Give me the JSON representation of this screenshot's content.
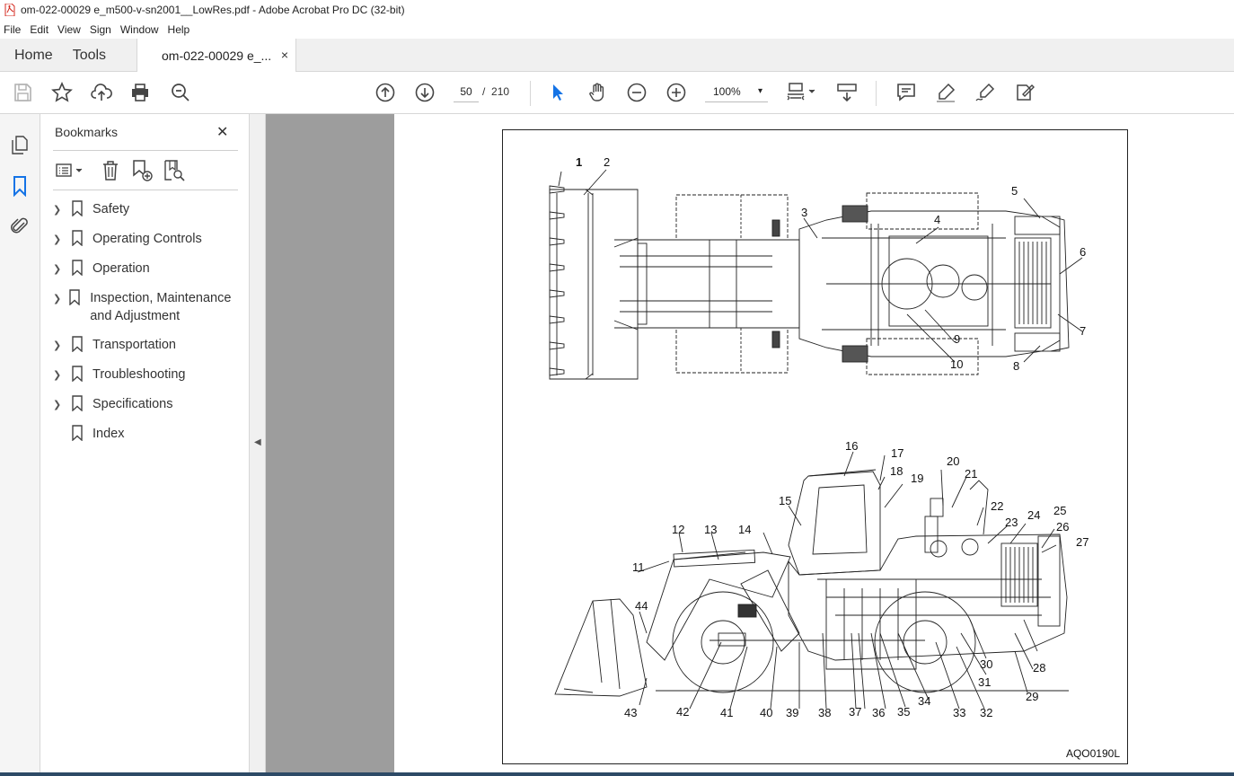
{
  "window": {
    "title": "om-022-00029 e_m500-v-sn2001__LowRes.pdf - Adobe Acrobat Pro DC (32-bit)"
  },
  "menu": [
    "File",
    "Edit",
    "View",
    "Sign",
    "Window",
    "Help"
  ],
  "tabs": {
    "home": "Home",
    "tools": "Tools",
    "document": "om-022-00029 e_...",
    "close": "×"
  },
  "toolbar": {
    "page_current": "50",
    "page_separator": "/",
    "page_total": "210",
    "zoom": "100%",
    "zoom_caret": "▾"
  },
  "bookmarks": {
    "title": "Bookmarks",
    "close": "✕",
    "items": [
      {
        "label": "Safety",
        "expandable": true
      },
      {
        "label": "Operating Controls",
        "expandable": true
      },
      {
        "label": "Operation",
        "expandable": true
      },
      {
        "label": "Inspection, Maintenance and Adjustment",
        "expandable": true
      },
      {
        "label": "Transportation",
        "expandable": true
      },
      {
        "label": "Troubleshooting",
        "expandable": true
      },
      {
        "label": "Specifications",
        "expandable": true
      },
      {
        "label": "Index",
        "expandable": false
      }
    ]
  },
  "document": {
    "figure_code": "AQO0190L",
    "callouts": [
      "1",
      "2",
      "3",
      "4",
      "5",
      "6",
      "7",
      "8",
      "9",
      "10",
      "11",
      "12",
      "13",
      "14",
      "15",
      "16",
      "17",
      "18",
      "19",
      "20",
      "21",
      "22",
      "23",
      "24",
      "25",
      "26",
      "27",
      "28",
      "29",
      "30",
      "31",
      "32",
      "33",
      "34",
      "35",
      "36",
      "37",
      "38",
      "39",
      "40",
      "41",
      "42",
      "43",
      "44"
    ]
  },
  "colors": {
    "accent_blue": "#1473e6",
    "gray_pane": "#9d9d9d",
    "pdf_red": "#d42a1f"
  }
}
